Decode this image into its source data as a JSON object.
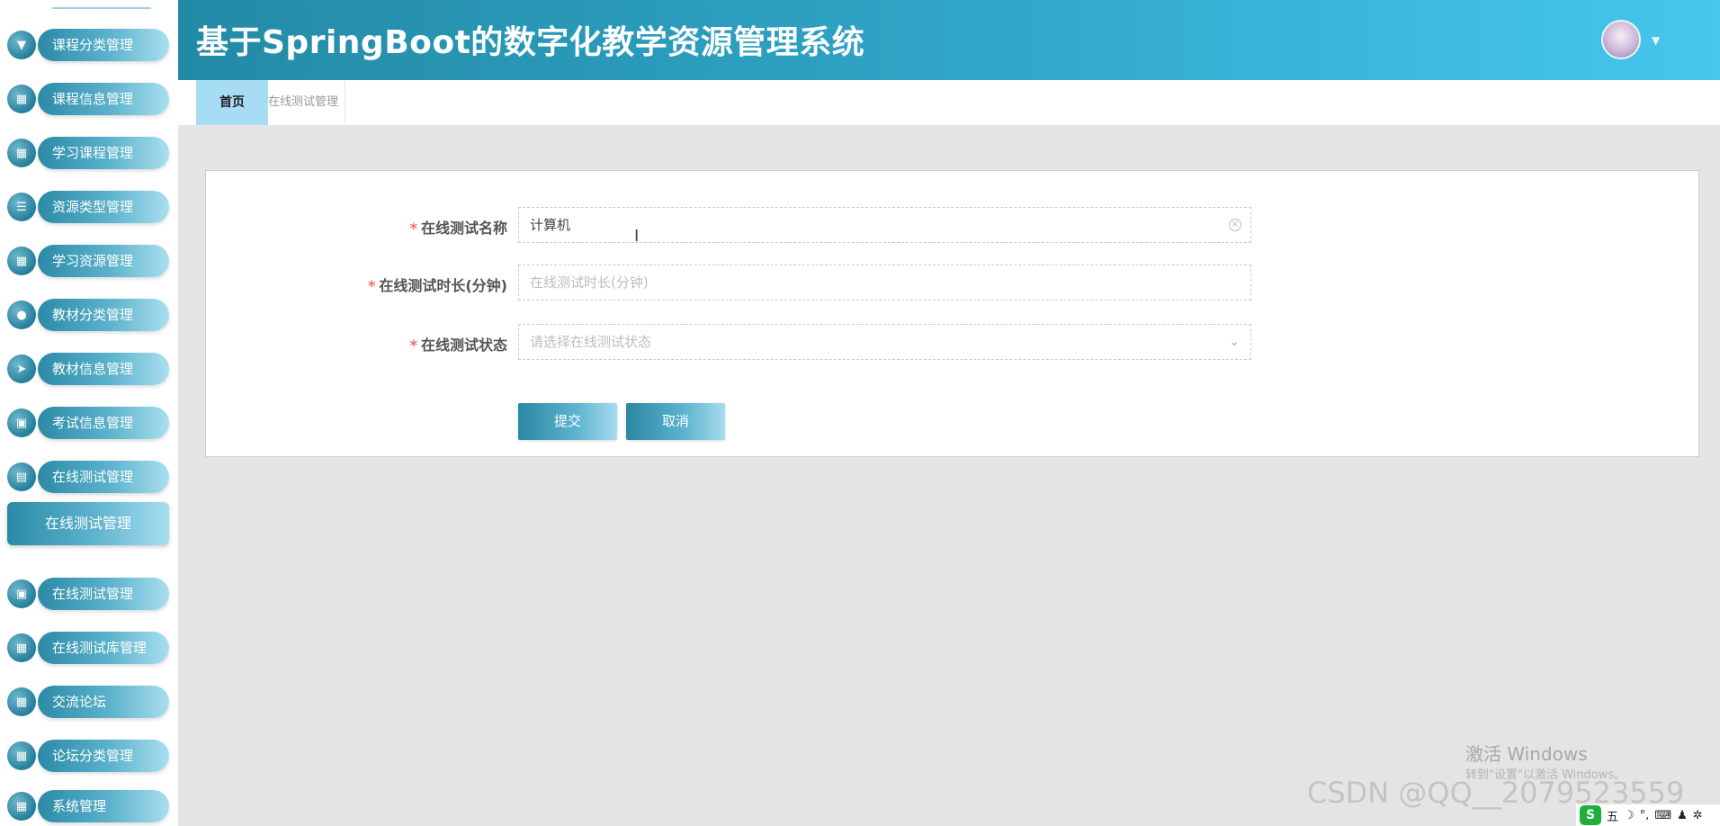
{
  "header": {
    "title": "基于SpringBoot的数字化教学资源管理系统"
  },
  "sidebar": {
    "items": [
      {
        "label": "课程分类管理",
        "icon": "pin-icon",
        "glyph": "▼"
      },
      {
        "label": "课程信息管理",
        "icon": "grid-icon",
        "glyph": "▦"
      },
      {
        "label": "学习课程管理",
        "icon": "grid-icon",
        "glyph": "▦"
      },
      {
        "label": "资源类型管理",
        "icon": "list-icon",
        "glyph": "☰"
      },
      {
        "label": "学习资源管理",
        "icon": "grid-icon",
        "glyph": "▦"
      },
      {
        "label": "教材分类管理",
        "icon": "user-icon",
        "glyph": "●"
      },
      {
        "label": "教材信息管理",
        "icon": "send-icon",
        "glyph": "➤"
      },
      {
        "label": "考试信息管理",
        "icon": "clipboard-icon",
        "glyph": "▣"
      },
      {
        "label": "在线测试管理",
        "icon": "briefcase-icon",
        "glyph": "▤"
      }
    ],
    "active_sub": "在线测试管理",
    "items_after": [
      {
        "label": "在线测试管理",
        "icon": "clipboard-icon",
        "glyph": "▣"
      },
      {
        "label": "在线测试库管理",
        "icon": "grid-icon",
        "glyph": "▦"
      },
      {
        "label": "交流论坛",
        "icon": "grid-icon",
        "glyph": "▦"
      },
      {
        "label": "论坛分类管理",
        "icon": "grid-icon",
        "glyph": "▦"
      },
      {
        "label": "系统管理",
        "icon": "grid-icon",
        "glyph": "▦"
      }
    ]
  },
  "tabs": {
    "home": "首页",
    "current": "在线测试管理"
  },
  "form": {
    "fields": [
      {
        "required": "*",
        "label": "在线测试名称",
        "value": "计算机",
        "placeholder": ""
      },
      {
        "required": "*",
        "label": "在线测试时长(分钟)",
        "value": "",
        "placeholder": "在线测试时长(分钟)"
      },
      {
        "required": "*",
        "label": "在线测试状态",
        "value": "",
        "placeholder": "请选择在线测试状态"
      }
    ],
    "submit_label": "提交",
    "cancel_label": "取消"
  },
  "overlay": {
    "activate_title": "激活 Windows",
    "activate_sub": "转到\"设置\"以激活 Windows。",
    "watermark": "CSDN @QQ__2079523559",
    "tray_logo": "S",
    "tray_items": [
      "五",
      "☽",
      "°,",
      "⌨",
      "♟",
      "✲"
    ]
  },
  "colors": {
    "accent": "#2fa5c7",
    "required": "#f56c6c",
    "tab_home_bg": "#a7dcf5"
  }
}
